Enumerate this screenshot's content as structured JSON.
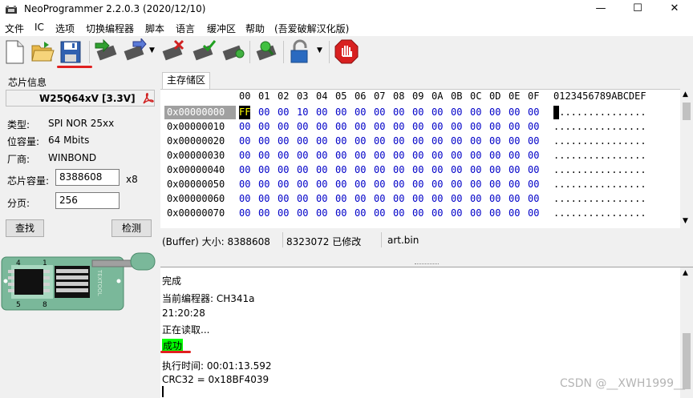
{
  "window": {
    "title": "NeoProgrammer 2.2.0.3 (2020/12/10)",
    "minimize": "—",
    "maximize": "☐",
    "close": "✕"
  },
  "menu": [
    "文件",
    "IC",
    "选项",
    "切换编程器",
    "脚本",
    "语言",
    "缓冲区",
    "帮助",
    "(吾爱破解汉化版)"
  ],
  "toolbar": {
    "icons": [
      "new-file-icon",
      "open-folder-icon",
      "save-disk-icon",
      "read-chip-icon",
      "write-chip-icon",
      "erase-chip-icon",
      "verify-chip-icon",
      "blank-check-icon",
      "auto-detect-icon",
      "lock-icon",
      "stop-icon"
    ]
  },
  "chip_info": {
    "group_title": "芯片信息",
    "chip_name": "W25Q64xV [3.3V]",
    "type_label": "类型:",
    "type_value": "SPI NOR 25xx",
    "capacity_label": "位容量:",
    "capacity_value": "64 Mbits",
    "vendor_label": "厂商:",
    "vendor_value": "WINBOND",
    "chip_size_label": "芯片容量:",
    "chip_size_value": "8388608",
    "chip_size_unit": "x8",
    "page_label": "分页:",
    "page_value": "256",
    "find_button": "查找",
    "detect_button": "检测"
  },
  "socket": {
    "pin_top_left": "4",
    "pin_top_right": "1",
    "pin_bottom_left": "5",
    "pin_bottom_right": "8",
    "brand": "TEXTOOL"
  },
  "tabs": [
    "主存储区"
  ],
  "hex": {
    "header_cols": [
      "00",
      "01",
      "02",
      "03",
      "04",
      "05",
      "06",
      "07",
      "08",
      "09",
      "0A",
      "0B",
      "0C",
      "0D",
      "0E",
      "0F"
    ],
    "ascii_header": "0123456789ABCDEF",
    "rows": [
      {
        "addr": "0x00000000",
        "bytes": [
          "FF",
          "00",
          "00",
          "10",
          "00",
          "00",
          "00",
          "00",
          "00",
          "00",
          "00",
          "00",
          "00",
          "00",
          "00",
          "00"
        ],
        "ascii": "................"
      },
      {
        "addr": "0x00000010",
        "bytes": [
          "00",
          "00",
          "00",
          "00",
          "00",
          "00",
          "00",
          "00",
          "00",
          "00",
          "00",
          "00",
          "00",
          "00",
          "00",
          "00"
        ],
        "ascii": "................"
      },
      {
        "addr": "0x00000020",
        "bytes": [
          "00",
          "00",
          "00",
          "00",
          "00",
          "00",
          "00",
          "00",
          "00",
          "00",
          "00",
          "00",
          "00",
          "00",
          "00",
          "00"
        ],
        "ascii": "................"
      },
      {
        "addr": "0x00000030",
        "bytes": [
          "00",
          "00",
          "00",
          "00",
          "00",
          "00",
          "00",
          "00",
          "00",
          "00",
          "00",
          "00",
          "00",
          "00",
          "00",
          "00"
        ],
        "ascii": "................"
      },
      {
        "addr": "0x00000040",
        "bytes": [
          "00",
          "00",
          "00",
          "00",
          "00",
          "00",
          "00",
          "00",
          "00",
          "00",
          "00",
          "00",
          "00",
          "00",
          "00",
          "00"
        ],
        "ascii": "................"
      },
      {
        "addr": "0x00000050",
        "bytes": [
          "00",
          "00",
          "00",
          "00",
          "00",
          "00",
          "00",
          "00",
          "00",
          "00",
          "00",
          "00",
          "00",
          "00",
          "00",
          "00"
        ],
        "ascii": "................"
      },
      {
        "addr": "0x00000060",
        "bytes": [
          "00",
          "00",
          "00",
          "00",
          "00",
          "00",
          "00",
          "00",
          "00",
          "00",
          "00",
          "00",
          "00",
          "00",
          "00",
          "00"
        ],
        "ascii": "................"
      },
      {
        "addr": "0x00000070",
        "bytes": [
          "00",
          "00",
          "00",
          "00",
          "00",
          "00",
          "00",
          "00",
          "00",
          "00",
          "00",
          "00",
          "00",
          "00",
          "00",
          "00"
        ],
        "ascii": "................"
      }
    ]
  },
  "status": {
    "buffer": "(Buffer) 大小: 8388608",
    "modified": "8323072 已修改",
    "file": "art.bin"
  },
  "log": {
    "done": "完成",
    "programmer": "当前编程器: CH341a",
    "time": "21:20:28",
    "reading": "正在读取...",
    "success": "成功",
    "exec_time": "执行时间:    00:01:13.592",
    "crc": "CRC32 = 0x18BF4039"
  },
  "watermark": "CSDN @__XWH1999__",
  "colors": {
    "hex_value": "#0000c8",
    "cursor_bg": "#000000",
    "cursor_fg": "#ffff00",
    "success_bg": "#00ff00",
    "annotation": "#e02020"
  }
}
